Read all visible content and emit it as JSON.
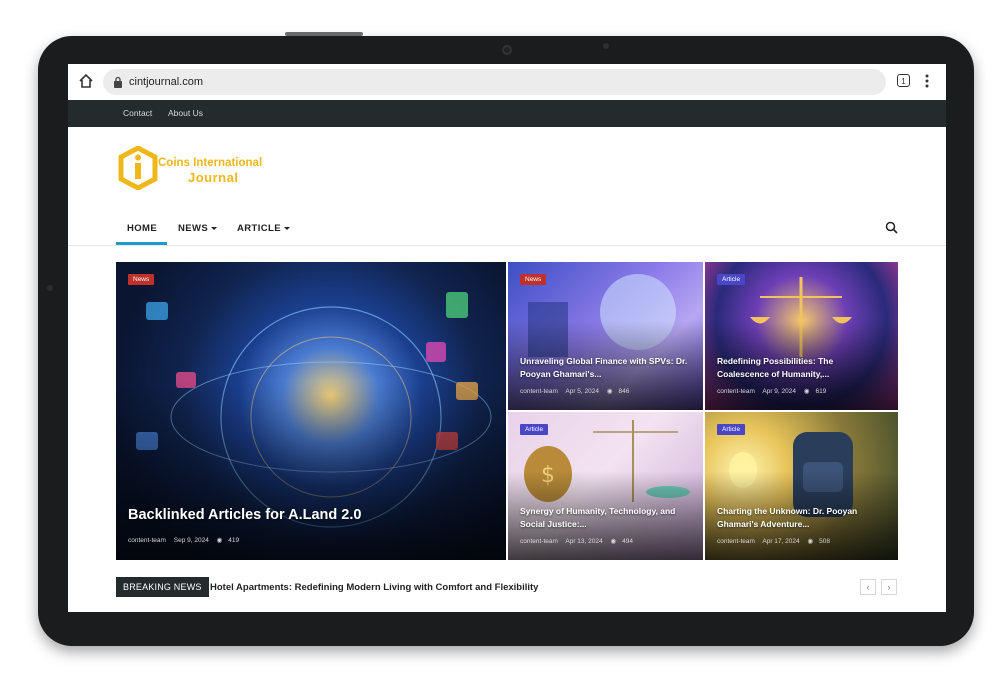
{
  "browser": {
    "url": "cintjournal.com",
    "tab_count": "1"
  },
  "topbar": {
    "links": [
      "Contact",
      "About Us"
    ]
  },
  "logo": {
    "line1": "Coins International",
    "line2": "Journal"
  },
  "nav": {
    "items": [
      "HOME",
      "NEWS",
      "ARTICLE"
    ],
    "active": "HOME"
  },
  "featured": [
    {
      "category": "News",
      "title": "Backlinked Articles for A.Land 2.0",
      "author": "content-team",
      "date": "Sep 9, 2024",
      "views": "419"
    },
    {
      "category": "News",
      "title": "Unraveling Global Finance with SPVs: Dr. Pooyan Ghamari's...",
      "author": "content-team",
      "date": "Apr 5, 2024",
      "views": "846"
    },
    {
      "category": "Article",
      "title": "Redefining Possibilities: The Coalescence of Humanity,...",
      "author": "content-team",
      "date": "Apr 9, 2024",
      "views": "619"
    },
    {
      "category": "Article",
      "title": "Synergy of Humanity, Technology, and Social Justice:...",
      "author": "content-team",
      "date": "Apr 13, 2024",
      "views": "494"
    },
    {
      "category": "Article",
      "title": "Charting the Unknown: Dr. Pooyan Ghamari's Adventure...",
      "author": "content-team",
      "date": "Apr 17, 2024",
      "views": "508"
    }
  ],
  "breaking": {
    "label": "BREAKING NEWS",
    "headline": "Hotel Apartments: Redefining Modern Living with Comfort and Flexibility",
    "prev": "‹",
    "next": "›"
  }
}
